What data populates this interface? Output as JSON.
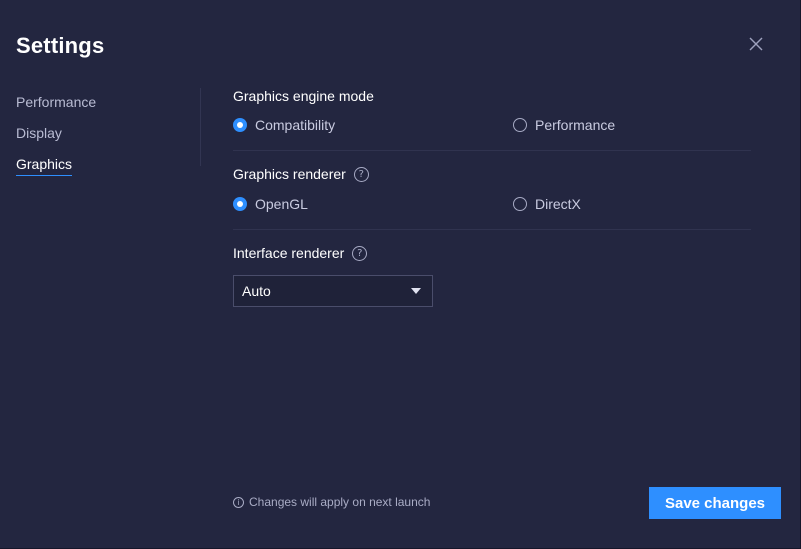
{
  "window": {
    "title": "Settings",
    "close_icon": "close-icon"
  },
  "sidebar": {
    "items": [
      {
        "label": "Performance",
        "active": false
      },
      {
        "label": "Display",
        "active": false
      },
      {
        "label": "Graphics",
        "active": true
      }
    ]
  },
  "graphics": {
    "engine_mode": {
      "title": "Graphics engine mode",
      "options": [
        {
          "label": "Compatibility",
          "selected": true
        },
        {
          "label": "Performance",
          "selected": false
        }
      ]
    },
    "renderer": {
      "title": "Graphics renderer",
      "help_icon": "help-icon",
      "options": [
        {
          "label": "OpenGL",
          "selected": true
        },
        {
          "label": "DirectX",
          "selected": false
        }
      ]
    },
    "interface_renderer": {
      "title": "Interface renderer",
      "help_icon": "help-icon",
      "selected_value": "Auto"
    }
  },
  "footer": {
    "note": "Changes will apply on next launch",
    "info_icon": "info-icon",
    "save_label": "Save changes"
  },
  "colors": {
    "accent": "#2e8fff",
    "background": "#232640"
  }
}
